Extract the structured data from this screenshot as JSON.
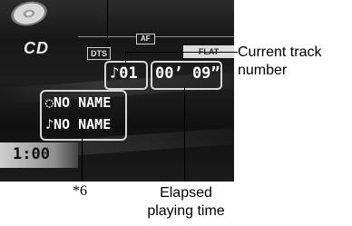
{
  "display": {
    "mode": "CD",
    "dts": "DTS",
    "af": "AF",
    "eq": "FLAT",
    "track_number": "♪01",
    "elapsed_time": "00’ 09”",
    "disc_title": "◌NO NAME",
    "track_title": "♪NO NAME",
    "clock": "1:00"
  },
  "callouts": {
    "track": [
      "Current track",
      "number"
    ],
    "elapsed": [
      "Elapsed",
      "playing time"
    ],
    "names_note": "*6"
  },
  "icons": {
    "disc": "cd-disc-icon"
  },
  "colors": {
    "screen": "#161616",
    "text": "#ffffff",
    "flat_bg": "#dcdcdc"
  }
}
